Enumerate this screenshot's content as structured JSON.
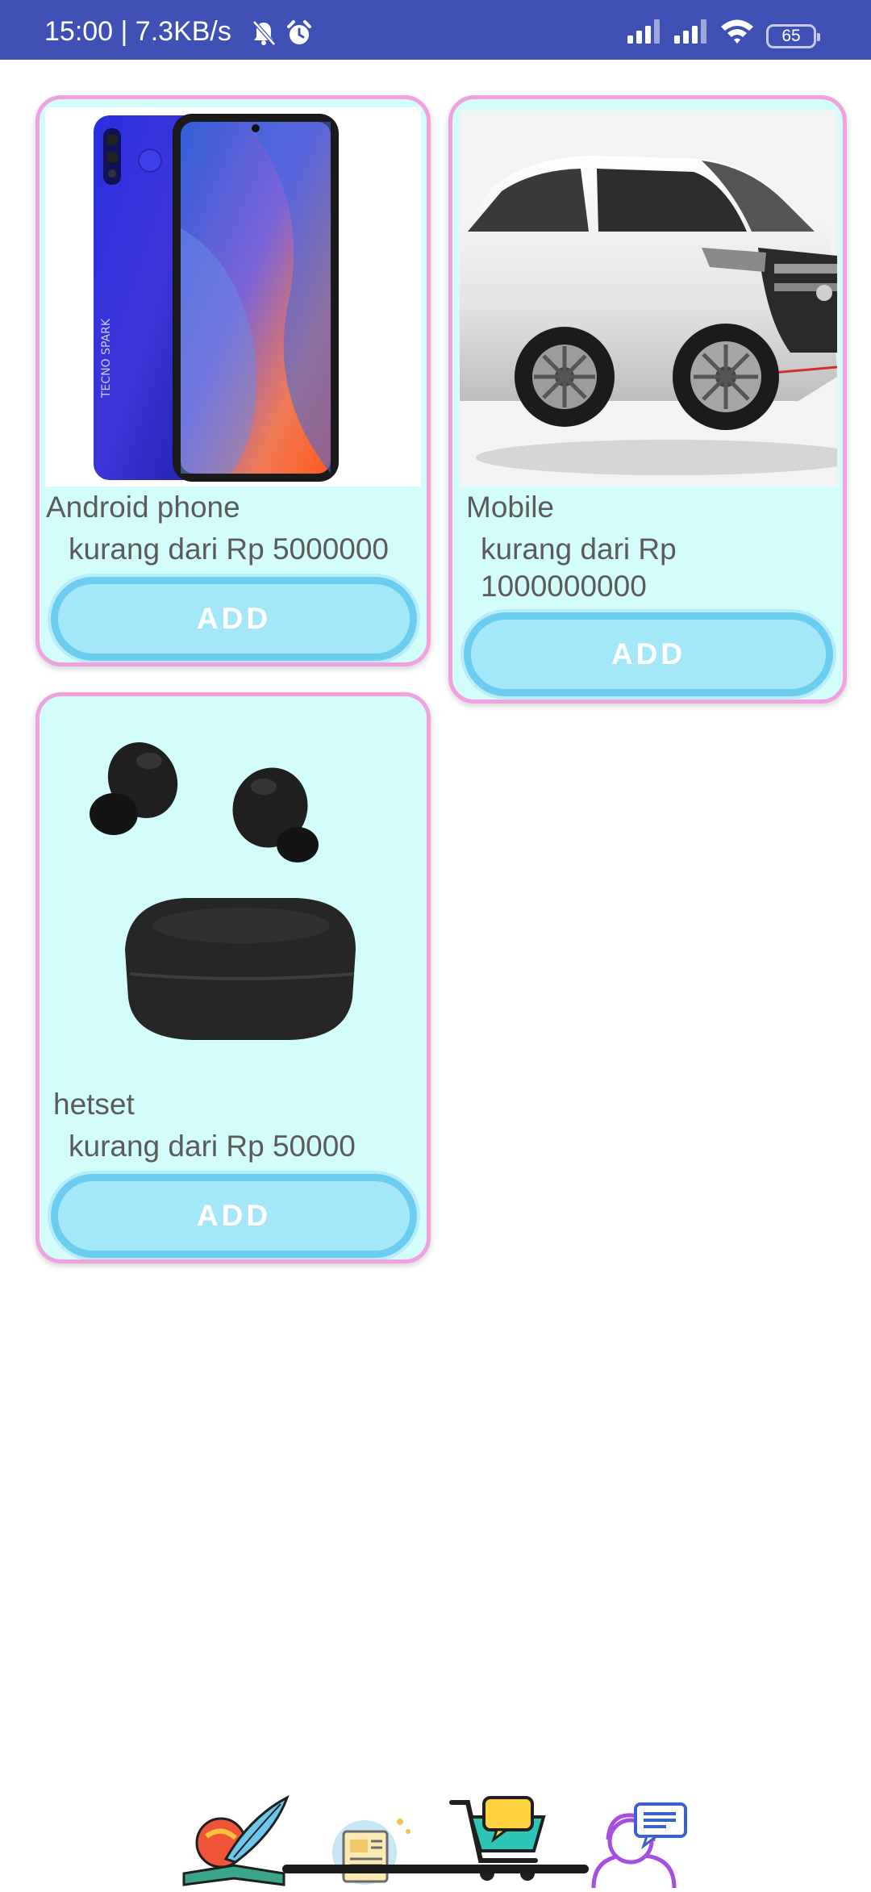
{
  "status_bar": {
    "time_speed": "15:00 | 7.3KB/s",
    "battery_level": "65",
    "icons": [
      "bell-off-icon",
      "alarm-icon",
      "signal-icon",
      "signal-icon",
      "wifi-icon",
      "battery-icon"
    ],
    "background_color": "#3f51b5"
  },
  "products": [
    {
      "name": "Android phone",
      "price": "kurang dari Rp 5000000",
      "button": "ADD",
      "image": "smartphone-image"
    },
    {
      "name": "Mobile",
      "price": "kurang dari Rp 1000000000",
      "button": "ADD",
      "image": "car-image"
    },
    {
      "name": "hetset",
      "price": "kurang dari Rp 50000",
      "button": "ADD",
      "image": "earbuds-image"
    }
  ],
  "bottom_nav": {
    "items": [
      "book-quill-icon",
      "newspaper-icon",
      "cart-chat-icon",
      "support-agent-icon"
    ]
  },
  "colors": {
    "card_background": "#d3fdfb",
    "card_border": "#f0a2e0",
    "button_fill": "#a3e7f8",
    "button_border": "#6ccdf1",
    "text": "#5b5b5b"
  }
}
